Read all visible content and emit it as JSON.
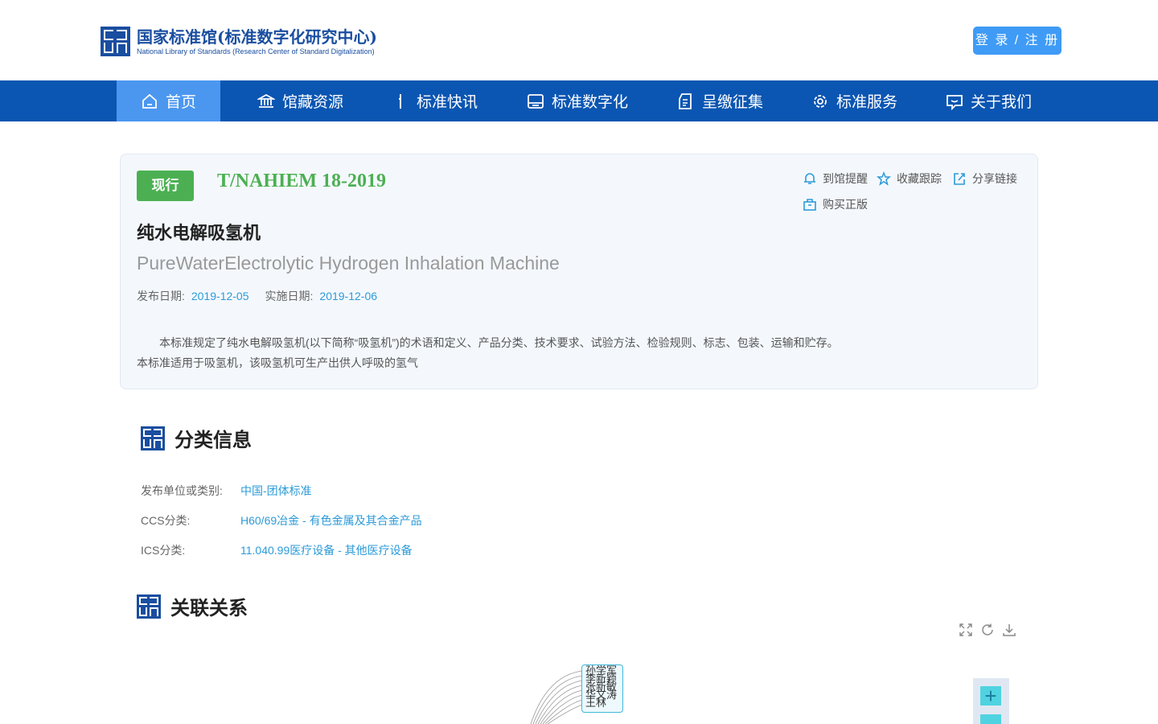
{
  "header": {
    "logo_cn": "国家标准馆(标准数字化研究中心)",
    "logo_en": "National Library of Standards (Research Center of Standard Digitalization)",
    "login_label": "登 录 / 注 册"
  },
  "nav": {
    "items": [
      {
        "label": "首页",
        "icon": "home-icon",
        "active": true
      },
      {
        "label": "馆藏资源",
        "icon": "library-icon"
      },
      {
        "label": "标准快讯",
        "icon": "news-icon"
      },
      {
        "label": "标准数字化",
        "icon": "digital-icon"
      },
      {
        "label": "呈缴征集",
        "icon": "collect-icon"
      },
      {
        "label": "标准服务",
        "icon": "service-icon"
      },
      {
        "label": "关于我们",
        "icon": "about-icon"
      }
    ]
  },
  "standard": {
    "status": "现行",
    "code": "T/NAHIEM 18-2019",
    "title_cn": "纯水电解吸氢机",
    "title_en": "PureWaterElectrolytic Hydrogen Inhalation Machine",
    "publish_label": "发布日期:",
    "publish_date": "2019-12-05",
    "effective_label": "实施日期:",
    "effective_date": "2019-12-06",
    "desc_line1": "本标准规定了纯水电解吸氢机(以下简称“吸氢机”)的术语和定义、产品分类、技术要求、试验方法、检验规则、标志、包装、运输和贮存。",
    "desc_line2": "本标准适用于吸氢机，该吸氢机可生产出供人呼吸的氢气"
  },
  "actions": {
    "remind": "到馆提醒",
    "track": "收藏跟踪",
    "share": "分享链接",
    "buy": "购买正版"
  },
  "classification": {
    "title": "分类信息",
    "rows": [
      {
        "label": "发布单位或类别:",
        "value": "中国-团体标准"
      },
      {
        "label": "CCS分类:",
        "value": "H60/69冶金 - 有色金属及其合金产品"
      },
      {
        "label": "ICS分类:",
        "value": "11.040.99医疗设备 - 其他医疗设备"
      }
    ]
  },
  "relations": {
    "title": "关联关系",
    "node_text": "孙学军 李新颖 张新敏 华文涛 王林",
    "zoom_in": "+"
  },
  "colors": {
    "brand": "#0b56b2",
    "nav_active": "#4b97f0",
    "status_green": "#4cb052",
    "link_blue": "#2d9bd8"
  }
}
